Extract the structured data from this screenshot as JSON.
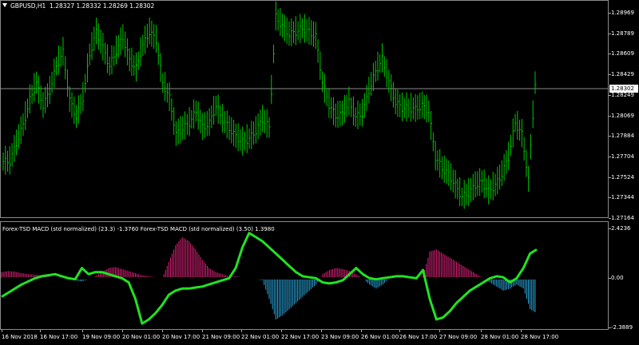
{
  "chart": {
    "symbol_title": "GBPUSD,H1",
    "ohlc": "1.28327 1.28332 1.28269 1.28302",
    "current_price": "1.28302",
    "price_ticks": [
      "1.28969",
      "1.28789",
      "1.28609",
      "1.28429",
      "1.28249",
      "1.28069",
      "1.27884",
      "1.27704",
      "1.27524",
      "1.27344",
      "1.27164"
    ],
    "indicator_title": "Forex-TSD MACD (std normalized) (23.3) -1.3760  Forex-TSD MACD (std normalized) (3.50) 1.3980",
    "indicator_ticks": [
      "2.4236",
      "0.00",
      "-2.3889"
    ],
    "time_ticks": [
      "16 Nov 2018",
      "16 Nov 17:00",
      "19 Nov 09:00",
      "20 Nov 01:00",
      "20 Nov 17:00",
      "21 Nov 09:00",
      "22 Nov 01:00",
      "22 Nov 17:00",
      "23 Nov 09:00",
      "26 Nov 01:00",
      "26 Nov 17:00",
      "27 Nov 09:00",
      "28 Nov 01:00",
      "28 Nov 17:00"
    ],
    "colors": {
      "background": "#000000",
      "candle": "#00c800",
      "histogram_positive": "#e0207a",
      "histogram_negative": "#29a9e0",
      "signal_line": "#22e222",
      "zero_line": "#000000",
      "grid_border": "#8a8a8a"
    }
  },
  "chart_data": {
    "type": "line",
    "series": [
      {
        "name": "GBPUSD,H1",
        "values": [
          1.2766,
          1.2782,
          1.2798,
          1.282,
          1.2835,
          1.2815,
          1.2828,
          1.285,
          1.2862,
          1.282,
          1.2805,
          1.2822,
          1.286,
          1.288,
          1.2866,
          1.285,
          1.2863,
          1.2875,
          1.2855,
          1.2848,
          1.2868,
          1.288,
          1.2873,
          1.2835,
          1.2822,
          1.279,
          1.2795,
          1.28,
          1.281,
          1.2796,
          1.28,
          1.2815,
          1.2803,
          1.2795,
          1.2788,
          1.2783,
          1.2786,
          1.2793,
          1.2803,
          1.2796,
          1.2893,
          1.2885,
          1.2878,
          1.288,
          1.2883,
          1.288,
          1.2876,
          1.2836,
          1.2816,
          1.2806,
          1.2808,
          1.2818,
          1.2805,
          1.2808,
          1.2828,
          1.2845,
          1.2856,
          1.2836,
          1.2818,
          1.2813,
          1.2813,
          1.2812,
          1.2815,
          1.281,
          1.277,
          1.276,
          1.2755,
          1.2745,
          1.2735,
          1.2738,
          1.2745,
          1.2748,
          1.274,
          1.2745,
          1.2755,
          1.277,
          1.28,
          1.279,
          1.275,
          1.2835,
          1.283
        ]
      }
    ],
    "indicator": {
      "histogram": [
        0.3,
        0.35,
        0.32,
        0.25,
        0.2,
        0.18,
        0.15,
        0.1,
        0.05,
        0.0,
        -0.05,
        -0.1,
        -0.15,
        -0.05,
        0.1,
        0.3,
        0.5,
        0.55,
        0.45,
        0.35,
        0.25,
        0.15,
        0.1,
        0.05,
        0.0,
        0.8,
        1.6,
        2.0,
        1.8,
        1.4,
        0.9,
        0.5,
        0.3,
        0.2,
        0.1,
        0.1,
        0.05,
        0.0,
        -0.05,
        -0.1,
        -1.0,
        -2.0,
        -1.8,
        -1.5,
        -1.2,
        -0.9,
        -0.6,
        -0.3,
        0.2,
        0.4,
        0.5,
        0.45,
        0.35,
        0.2,
        0.0,
        -0.3,
        -0.5,
        -0.3,
        0.05,
        0.1,
        0.1,
        0.05,
        0.0,
        0.1,
        1.3,
        1.4,
        1.2,
        1.0,
        0.8,
        0.6,
        0.4,
        0.2,
        0.0,
        -0.2,
        -0.4,
        -0.6,
        -0.5,
        -0.3,
        -0.5,
        -1.5,
        -1.7
      ],
      "line": [
        -0.9,
        -0.7,
        -0.5,
        -0.3,
        -0.15,
        0.0,
        0.1,
        0.15,
        0.2,
        0.1,
        0.0,
        -0.05,
        0.5,
        0.2,
        0.3,
        0.3,
        0.2,
        0.1,
        0.0,
        -0.2,
        -1.0,
        -2.2,
        -2.0,
        -1.7,
        -1.3,
        -0.8,
        -0.6,
        -0.5,
        -0.5,
        -0.45,
        -0.4,
        -0.3,
        -0.2,
        -0.1,
        0.0,
        0.5,
        1.5,
        2.2,
        2.0,
        1.8,
        1.5,
        1.2,
        0.9,
        0.6,
        0.3,
        0.1,
        0.05,
        0.0,
        -0.2,
        -0.25,
        -0.2,
        -0.1,
        0.2,
        0.5,
        0.2,
        0.0,
        -0.05,
        0.0,
        0.05,
        0.1,
        0.1,
        0.05,
        0.0,
        0.4,
        -1.0,
        -2.0,
        -1.9,
        -1.6,
        -1.2,
        -0.9,
        -0.6,
        -0.4,
        -0.2,
        0.0,
        0.1,
        0.05,
        -0.2,
        0.0,
        0.5,
        1.2,
        1.4
      ],
      "ylim": [
        -2.3889,
        2.4236
      ]
    }
  }
}
